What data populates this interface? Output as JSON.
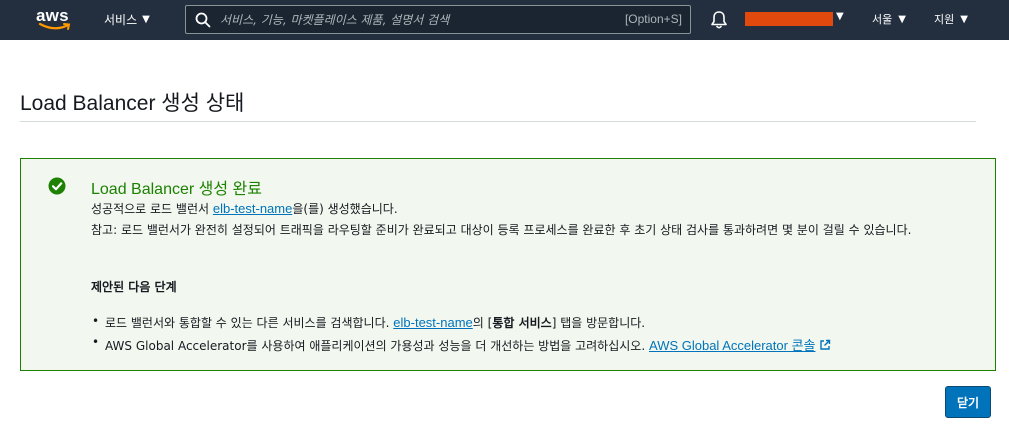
{
  "nav": {
    "logo_text": "aws",
    "services_label": "서비스",
    "search_placeholder": "서비스, 기능, 마켓플레이스 제품, 설명서 검색",
    "search_shortcut": "[Option+S]",
    "region_label": "서울",
    "support_label": "지원",
    "account_redacted_color": "#e24a0d"
  },
  "page": {
    "title": "Load Balancer 생성 상태"
  },
  "alert": {
    "title": "Load Balancer 생성 완료",
    "line1_prefix": "성공적으로 로드 밸런서",
    "lb_name": "elb-test-name",
    "line1_suffix": "을(를) 생성했습니다.",
    "line2": "참고: 로드 밸런서가 완전히 설정되어 트래픽을 라우팅할 준비가 완료되고 대상이 등록 프로세스를 완료한 후 초기 상태 검사를 통과하려면 몇 분이 걸릴 수 있습니다.",
    "next_steps_title": "제안된 다음 단계",
    "step1_prefix": "로드 밸런서와 통합할 수 있는 다른 서비스를 검색합니다.",
    "step1_link": "elb-test-name",
    "step1_mid": "의 [",
    "step1_bold": "통합 서비스",
    "step1_suffix": "] 탭을 방문합니다.",
    "step2_prefix": "AWS Global Accelerator를 사용하여 애플리케이션의 가용성과 성능을 더 개선하는 방법을 고려하십시오.",
    "step2_link": "AWS Global Accelerator 콘솔"
  },
  "footer": {
    "close_label": "닫기"
  },
  "colors": {
    "nav_bg": "#232f3e",
    "success": "#1d8102",
    "link": "#0073bb",
    "primary_button": "#0073bb"
  }
}
